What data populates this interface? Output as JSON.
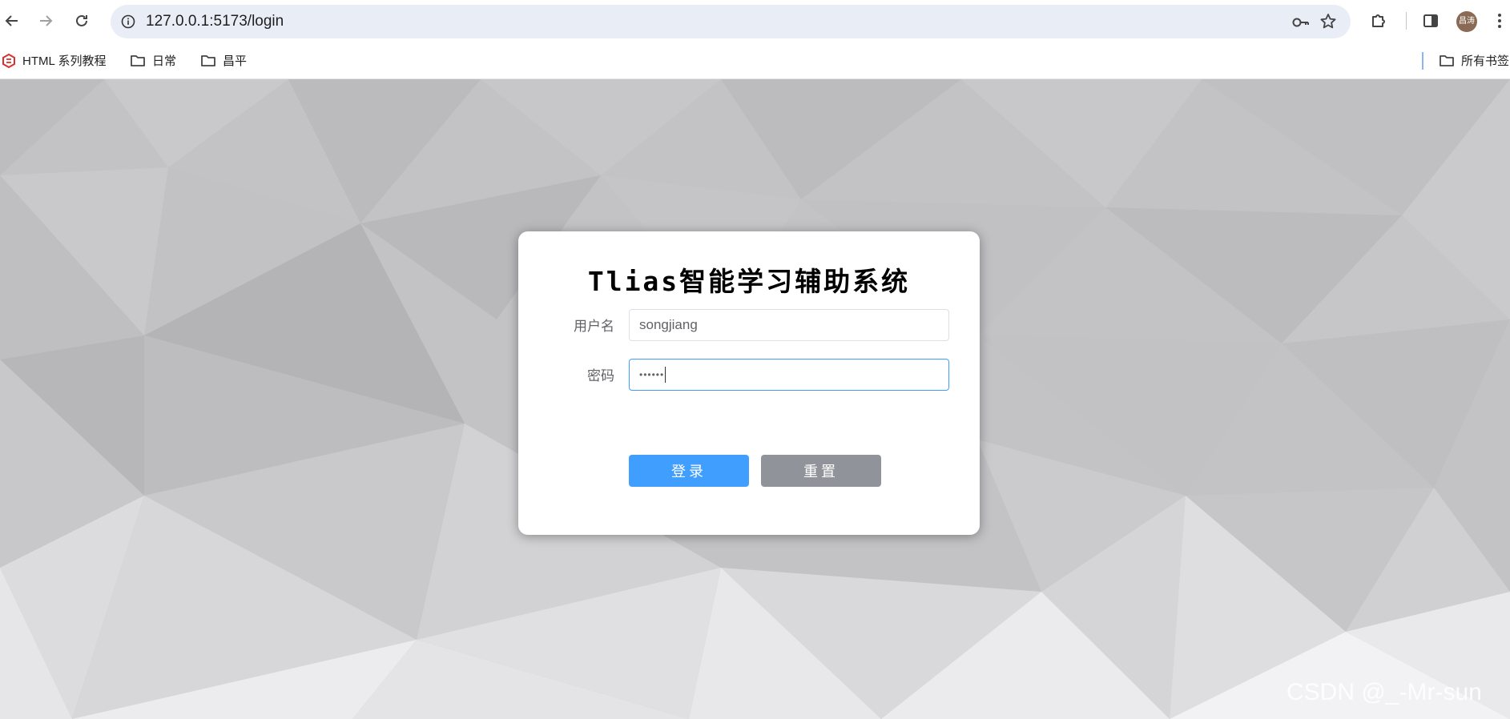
{
  "browser": {
    "url": "127.0.0.1:5173/login",
    "avatar_text": "昌涛",
    "bookmarks": [
      {
        "label": "HTML 系列教程"
      },
      {
        "label": "日常"
      },
      {
        "label": "昌平"
      }
    ],
    "all_bookmarks_label": "所有书签"
  },
  "login": {
    "title": "Tlias智能学习辅助系统",
    "username_label": "用户名",
    "username_value": "songjiang",
    "password_label": "密码",
    "password_value": "••••••",
    "login_button": "登录",
    "reset_button": "重置"
  },
  "watermark": "CSDN @_-Mr-sun"
}
